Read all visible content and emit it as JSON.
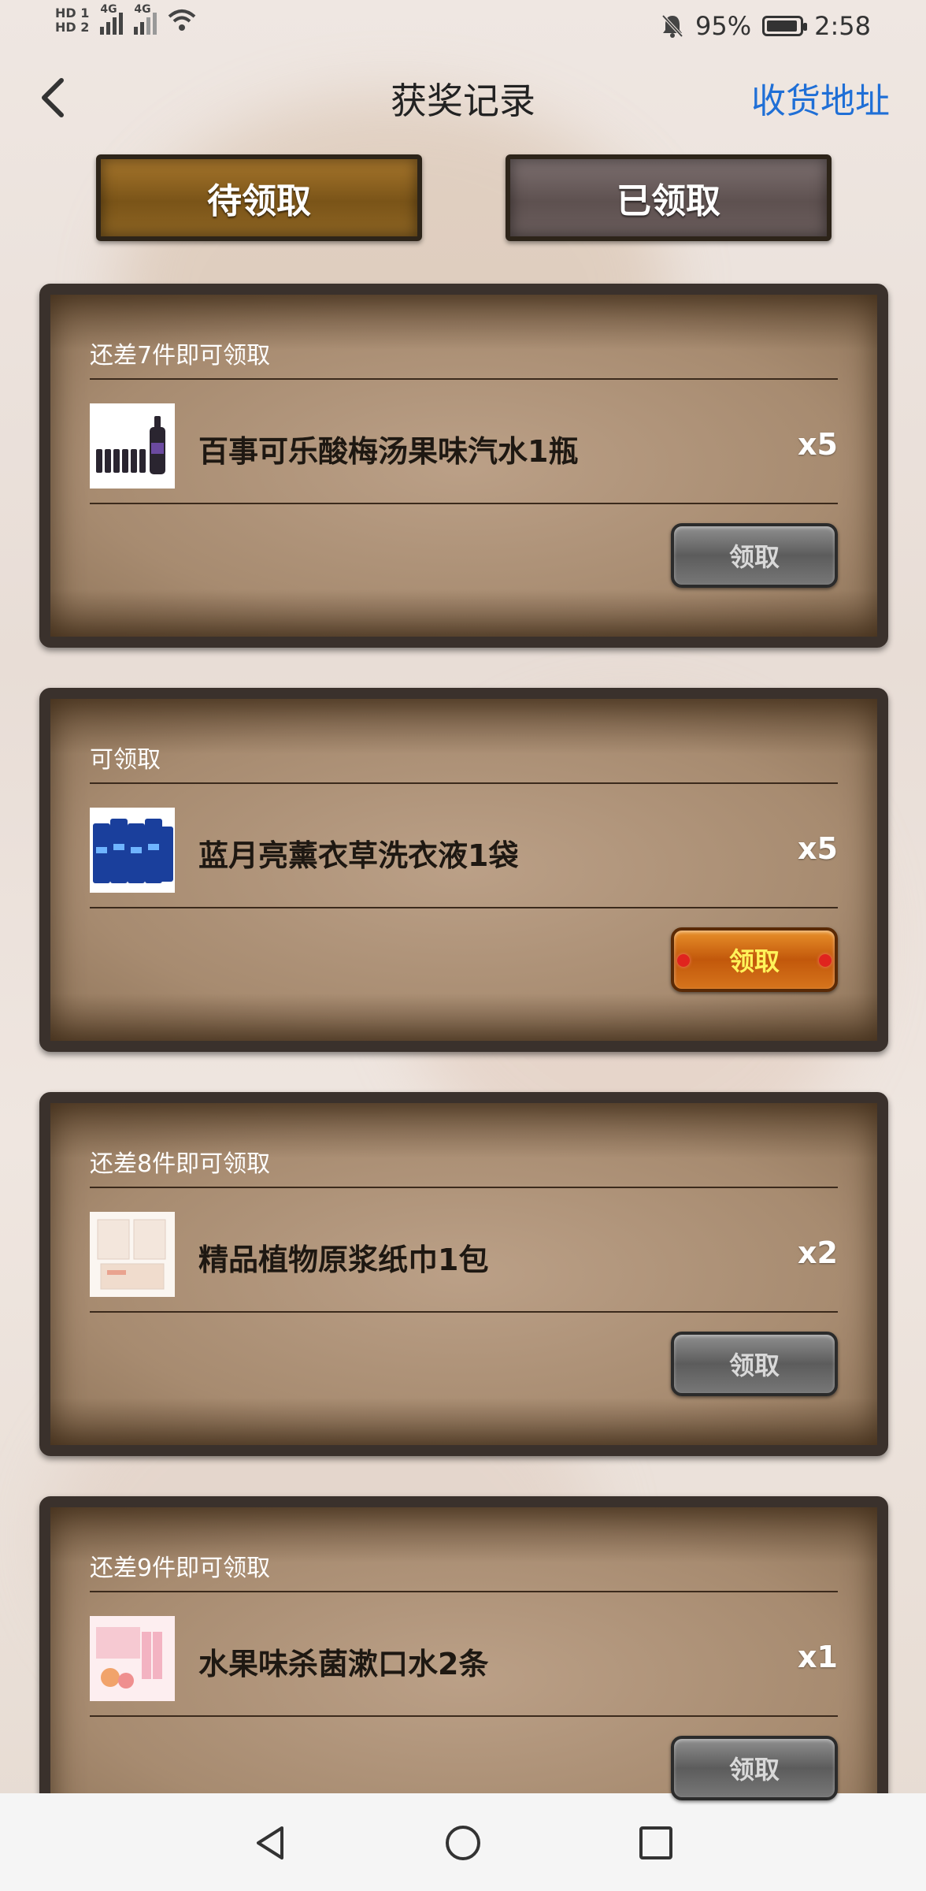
{
  "status_bar": {
    "hd1": "HD 1",
    "hd2": "HD 2",
    "net1": "4G",
    "net2": "4G",
    "battery_percent": "95%",
    "battery_level": 0.95,
    "time": "2:58"
  },
  "header": {
    "back_icon": "chevron-left-icon",
    "title": "获奖记录",
    "address_link": "收货地址"
  },
  "tabs": [
    {
      "label": "待领取",
      "selected": true
    },
    {
      "label": "已领取",
      "selected": false
    }
  ],
  "cards": [
    {
      "status": "还差7件即可领取",
      "product": "百事可乐酸梅汤果味汽水1瓶",
      "qty": "x5",
      "button": "领取",
      "enabled": false
    },
    {
      "status": "可领取",
      "product": "蓝月亮薰衣草洗衣液1袋",
      "qty": "x5",
      "button": "领取",
      "enabled": true
    },
    {
      "status": "还差8件即可领取",
      "product": "精品植物原浆纸巾1包",
      "qty": "x2",
      "button": "领取",
      "enabled": false
    },
    {
      "status": "还差9件即可领取",
      "product": "水果味杀菌漱口水2条",
      "qty": "x1",
      "button": "领取",
      "enabled": false
    }
  ],
  "colors": {
    "link": "#1f6fd6",
    "tab_pending": "#8a6120",
    "tab_claimed": "#655858",
    "claim_active": "#d36a17",
    "claim_disabled": "#6e6e6e"
  },
  "navbar": {
    "back": "triangle-back-icon",
    "home": "circle-home-icon",
    "recent": "square-recent-icon"
  }
}
